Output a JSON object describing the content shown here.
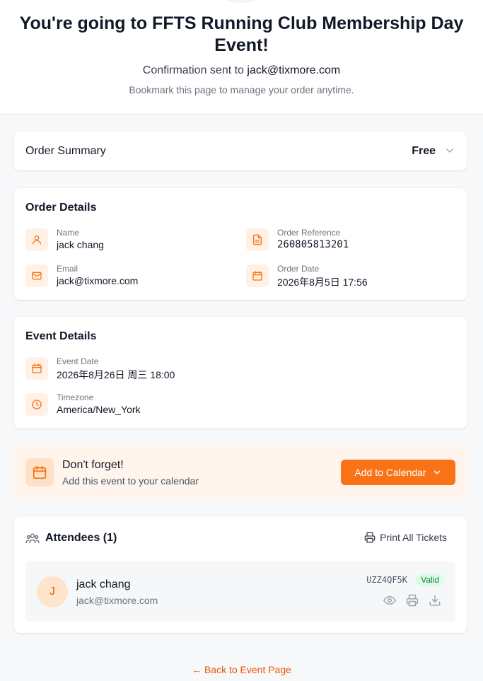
{
  "header": {
    "title": "You're going to FFTS Running Club Membership Day Event!",
    "confirmation_prefix": "Confirmation sent to",
    "confirmation_email": "jack@tixmore.com",
    "bookmark_note": "Bookmark this page to manage your order anytime."
  },
  "order_summary": {
    "title": "Order Summary",
    "price": "Free"
  },
  "order_details": {
    "title": "Order Details",
    "name_label": "Name",
    "name_value": "jack chang",
    "reference_label": "Order Reference",
    "reference_value": "260805813201",
    "email_label": "Email",
    "email_value": "jack@tixmore.com",
    "date_label": "Order Date",
    "date_value": "2026年8月5日 17:56"
  },
  "event_details": {
    "title": "Event Details",
    "date_label": "Event Date",
    "date_value": "2026年8月26日 周三 18:00",
    "timezone_label": "Timezone",
    "timezone_value": "America/New_York"
  },
  "reminder": {
    "title": "Don't forget!",
    "subtitle": "Add this event to your calendar",
    "button_label": "Add to Calendar"
  },
  "attendees": {
    "title": "Attendees (1)",
    "print_all_label": "Print All Tickets",
    "list": [
      {
        "initial": "J",
        "name": "jack chang",
        "email": "jack@tixmore.com",
        "ticket_code": "UZZ4QF5K",
        "status": "Valid"
      }
    ]
  },
  "back_link": "← Back to Event Page",
  "colors": {
    "accent": "#f97316",
    "accent_soft": "#fff1e6",
    "valid_bg": "#dcfce7",
    "valid_text": "#15803d"
  }
}
